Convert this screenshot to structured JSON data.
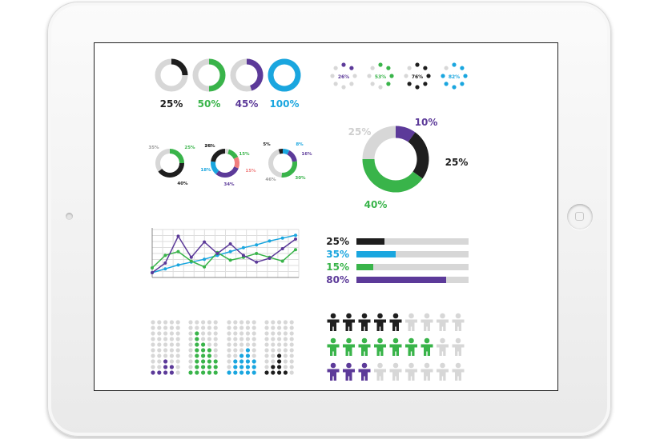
{
  "colors": {
    "black": "#1e1e1e",
    "green": "#39b44a",
    "purple": "#5c3a99",
    "blue": "#1aa6df",
    "gray": "#d7d7d7",
    "pink": "#f07e7e"
  },
  "chart_data": [
    {
      "type": "pie",
      "subtype": "single-donut-set",
      "items": [
        {
          "value": 25,
          "label": "25%",
          "color": "#1e1e1e"
        },
        {
          "value": 50,
          "label": "50%",
          "color": "#39b44a"
        },
        {
          "value": 45,
          "label": "45%",
          "color": "#5c3a99"
        },
        {
          "value": 100,
          "label": "100%",
          "color": "#1aa6df"
        }
      ]
    },
    {
      "type": "pie",
      "subtype": "dot-ring-set",
      "items": [
        {
          "label": "26%",
          "color": "#5c3a99",
          "lit": 2
        },
        {
          "label": "53%",
          "color": "#39b44a",
          "lit": 4
        },
        {
          "label": "76%",
          "color": "#1e1e1e",
          "lit": 6
        },
        {
          "label": "82%",
          "color": "#1aa6df",
          "lit": 7
        }
      ]
    },
    {
      "type": "pie",
      "subtype": "multi-donut-set",
      "donuts": [
        {
          "segments": [
            {
              "value": 25,
              "label": "25%",
              "color": "#39b44a"
            },
            {
              "value": 40,
              "label": "40%",
              "color": "#1e1e1e"
            },
            {
              "value": 35,
              "label": "35%",
              "color": "#d7d7d7"
            }
          ]
        },
        {
          "segments": [
            {
              "value": 5,
              "label": "5%",
              "color": "#d7d7d7"
            },
            {
              "value": 15,
              "label": "15%",
              "color": "#39b44a"
            },
            {
              "value": 15,
              "label": "15%",
              "color": "#f07e7e"
            },
            {
              "value": 34,
              "label": "34%",
              "color": "#5c3a99"
            },
            {
              "value": 18,
              "label": "18%",
              "color": "#1aa6df"
            },
            {
              "value": 26,
              "label": "26%",
              "color": "#1e1e1e"
            }
          ]
        },
        {
          "segments": [
            {
              "value": 8,
              "label": "8%",
              "color": "#1aa6df"
            },
            {
              "value": 16,
              "label": "16%",
              "color": "#5c3a99"
            },
            {
              "value": 30,
              "label": "30%",
              "color": "#39b44a"
            },
            {
              "value": 46,
              "label": "46%",
              "color": "#d7d7d7"
            },
            {
              "value": 5,
              "label": "5%",
              "color": "#1e1e1e"
            }
          ]
        }
      ]
    },
    {
      "type": "pie",
      "subtype": "big-donut",
      "segments": [
        {
          "value": 10,
          "label": "10%",
          "color": "#5c3a99"
        },
        {
          "value": 25,
          "label": "25%",
          "color": "#1e1e1e"
        },
        {
          "value": 40,
          "label": "40%",
          "color": "#39b44a"
        },
        {
          "value": 25,
          "label": "25%",
          "color": "#d7d7d7"
        }
      ]
    },
    {
      "type": "line",
      "ylim": [
        0,
        10
      ],
      "grid": true,
      "series": [
        {
          "color": "#1aa6df",
          "values": [
            1,
            1.8,
            2.6,
            3.2,
            3.8,
            4.6,
            5.4,
            6.2,
            6.8,
            7.6,
            8.2,
            8.8
          ]
        },
        {
          "color": "#39b44a",
          "values": [
            2,
            4.6,
            5.4,
            3.4,
            2.2,
            5.2,
            3.6,
            4.2,
            5,
            4.2,
            3.4,
            5.8
          ]
        },
        {
          "color": "#5c3a99",
          "values": [
            1,
            3,
            8.6,
            4.2,
            7.4,
            5,
            7,
            4.6,
            3.2,
            4,
            6,
            8
          ]
        }
      ]
    },
    {
      "type": "bar",
      "orientation": "horizontal",
      "xlim": [
        0,
        100
      ],
      "bars": [
        {
          "label": "25%",
          "value": 25,
          "color": "#1e1e1e"
        },
        {
          "label": "35%",
          "value": 35,
          "color": "#1aa6df"
        },
        {
          "label": "15%",
          "value": 15,
          "color": "#39b44a"
        },
        {
          "label": "80%",
          "value": 80,
          "color": "#5c3a99"
        }
      ]
    },
    {
      "type": "bar",
      "subtype": "dot-matrix-columns",
      "rows": 10,
      "groups": [
        {
          "color": "#5c3a99",
          "heights": [
            1,
            1,
            3,
            2
          ]
        },
        {
          "color": "#39b44a",
          "heights": [
            1,
            8,
            6,
            5,
            3
          ]
        },
        {
          "color": "#1aa6df",
          "heights": [
            1,
            3,
            4,
            5,
            3
          ]
        },
        {
          "color": "#1e1e1e",
          "heights": [
            1,
            2,
            4,
            1
          ]
        }
      ]
    },
    {
      "type": "bar",
      "subtype": "pictogram",
      "per_row": 9,
      "rows": [
        {
          "filled": 5,
          "color": "#1e1e1e"
        },
        {
          "filled": 7,
          "color": "#39b44a"
        },
        {
          "filled": 3,
          "color": "#5c3a99"
        }
      ]
    }
  ]
}
